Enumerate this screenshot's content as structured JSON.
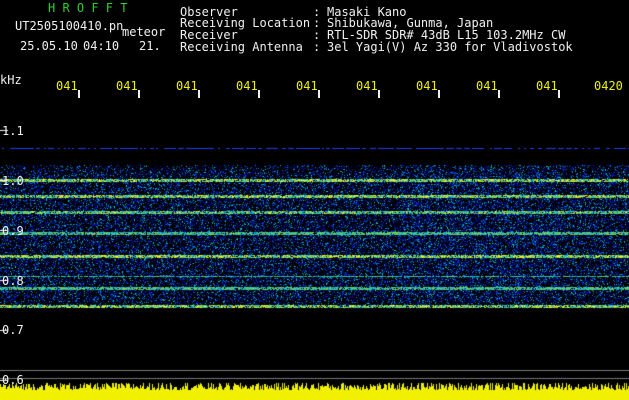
{
  "header": {
    "title": "H R O F F T",
    "filename": "UT2505100410.pn",
    "meteor": "meteor",
    "date": "25.05.10",
    "time": "04:10",
    "frame_no": "21.",
    "fields": [
      {
        "label": "Observer",
        "sep": ":",
        "value": "Masaki Kano"
      },
      {
        "label": "Receiving Location",
        "sep": ":",
        "value": "Shibukawa, Gunma, Japan"
      },
      {
        "label": "Receiver",
        "sep": ":",
        "value": "RTL-SDR SDR# 43dB L15 103.2MHz CW"
      },
      {
        "label": "Receiving Antenna",
        "sep": ":",
        "value": "3el Yagi(V) Az 330 for Vladivostok"
      }
    ]
  },
  "axis": {
    "unit": "kHz",
    "y_ticks": [
      "1.1",
      "1.0",
      "0.9",
      "0.8",
      "0.7",
      "0.6"
    ],
    "x_ticks": [
      "041",
      "041",
      "041",
      "041",
      "041",
      "041",
      "041",
      "041",
      "041",
      "0420"
    ]
  },
  "colors": {
    "background": "#000000",
    "text_white": "#f0f0f0",
    "text_green": "#2bd02b",
    "text_yellow": "#f0f000",
    "signal_low": "#0a1e8c",
    "signal_high": "#f0f000"
  }
}
